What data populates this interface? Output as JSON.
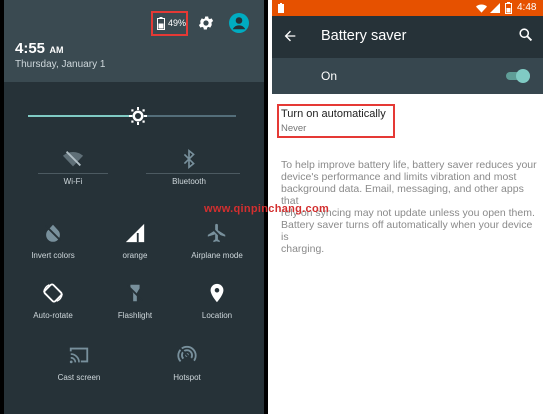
{
  "quick_settings": {
    "battery_percent": "49%",
    "time_main": "4:55",
    "time_suffix": "AM",
    "date": "Thursday, January 1",
    "brightness_level": 0.53,
    "tiles": [
      {
        "label": "Wi-Fi",
        "icon": "wifi-off-icon"
      },
      {
        "label": "Bluetooth",
        "icon": "bluetooth-icon"
      },
      {
        "label": "Invert colors",
        "icon": "invert-colors-icon"
      },
      {
        "label": "orange",
        "icon": "cellular-signal-icon"
      },
      {
        "label": "Airplane mode",
        "icon": "airplane-icon"
      },
      {
        "label": "Auto-rotate",
        "icon": "auto-rotate-icon"
      },
      {
        "label": "Flashlight",
        "icon": "flashlight-icon"
      },
      {
        "label": "Location",
        "icon": "location-pin-icon"
      },
      {
        "label": "Cast screen",
        "icon": "cast-icon"
      },
      {
        "label": "Hotspot",
        "icon": "hotspot-icon"
      }
    ]
  },
  "battery_saver": {
    "status_time": "4:48",
    "title": "Battery saver",
    "toggle_label": "On",
    "toggle_on": true,
    "auto_title": "Turn on automatically",
    "auto_value": "Never",
    "description_lines": [
      "To help improve battery life, battery saver reduces your",
      "device's performance and limits vibration and most",
      "background data. Email, messaging, and other apps that",
      "rely on syncing may not update unless you open them."
    ],
    "note_lines": [
      "Battery saver turns off automatically when your device is",
      "charging."
    ]
  },
  "watermark": "www.qinpinchang.com",
  "colors": {
    "accent_teal": "#80cbc4",
    "status_orange": "#e65100",
    "highlight_red": "#e53935",
    "avatar": "#00acc1"
  }
}
